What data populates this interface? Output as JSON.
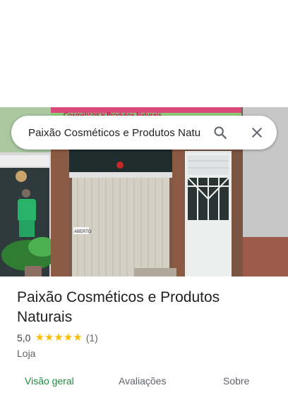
{
  "search": {
    "query": "Paixão Cosméticos e Produtos Natu"
  },
  "hero": {
    "sign_top": "PAIXÃO",
    "sign_sub": "Cosméticos e Produtos Naturais",
    "door_label": "ABERTO"
  },
  "place": {
    "name": "Paixão Cosméticos e Produtos Naturais",
    "rating": "5,0",
    "stars": 5,
    "review_count": "(1)",
    "category": "Loja"
  },
  "tabs": [
    {
      "label": "Visão geral",
      "active": true
    },
    {
      "label": "Avaliações",
      "active": false
    },
    {
      "label": "Sobre",
      "active": false
    }
  ],
  "colors": {
    "accent": "#1e8e3e",
    "star": "#fbbc04"
  }
}
